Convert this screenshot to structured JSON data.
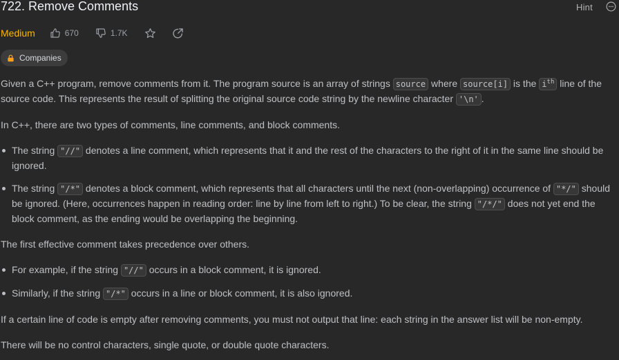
{
  "header": {
    "title": "722. Remove Comments",
    "hint_label": "Hint",
    "difficulty": "Medium",
    "likes": "670",
    "dislikes": "1.7K",
    "companies_label": "Companies"
  },
  "description": {
    "p1": {
      "t1": "Given a C++ program, remove comments from it. The program source is an array of strings ",
      "c1": "source",
      "t2": " where ",
      "c2": "source[i]",
      "t3": " is the ",
      "c3a": "i",
      "c3b": "th",
      "t4": " line of the source code. This represents the result of splitting the original source code string by the newline character ",
      "c4": "'\\n'",
      "t5": "."
    },
    "p2": "In C++, there are two types of comments, line comments, and block comments.",
    "list1": {
      "item1": {
        "t1": "The string ",
        "c1": "\"//\"",
        "t2": " denotes a line comment, which represents that it and the rest of the characters to the right of it in the same line should be ignored."
      },
      "item2": {
        "t1": "The string ",
        "c1": "\"/*\"",
        "t2": " denotes a block comment, which represents that all characters until the next (non-overlapping) occurrence of ",
        "c2": "\"*/\"",
        "t3": " should be ignored. (Here, occurrences happen in reading order: line by line from left to right.) To be clear, the string ",
        "c3": "\"/*/\"",
        "t4": " does not yet end the block comment, as the ending would be overlapping the beginning."
      }
    },
    "p3": "The first effective comment takes precedence over others.",
    "list2": {
      "item1": {
        "t1": "For example, if the string ",
        "c1": "\"//\"",
        "t2": " occurs in a block comment, it is ignored."
      },
      "item2": {
        "t1": "Similarly, if the string ",
        "c1": "\"/*\"",
        "t2": " occurs in a line or block comment, it is also ignored."
      }
    },
    "p4": "If a certain line of code is empty after removing comments, you must not output that line: each string in the answer list will be non-empty.",
    "p5": "There will be no control characters, single quote, or double quote characters."
  },
  "icons": {
    "more": "more-icon",
    "like": "thumbs-up-icon",
    "dislike": "thumbs-down-icon",
    "favorite": "star-icon",
    "share": "share-icon",
    "lock": "lock-icon"
  },
  "colors": {
    "background": "#282828",
    "difficulty_medium": "#ffb800",
    "companies_lock": "#ffa116"
  }
}
